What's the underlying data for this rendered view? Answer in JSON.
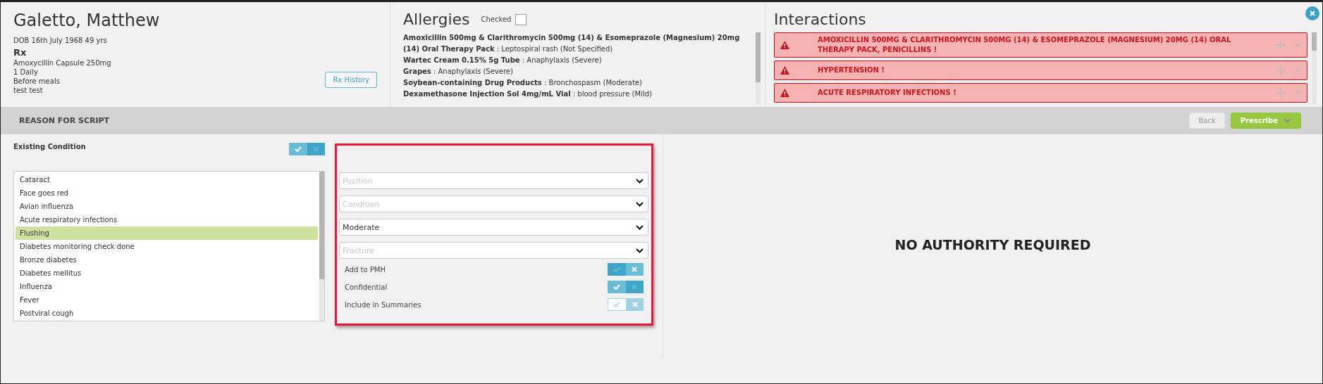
{
  "patient": {
    "name": "Galetto, Matthew",
    "dob": "DOB 16th July 1968 49 yrs",
    "rx_heading": "Rx",
    "rx_lines": [
      "Amoxycillin Capsule 250mg",
      "1 Daily",
      "Before meals",
      "test test"
    ],
    "history_button": "Rx History"
  },
  "allergies": {
    "title": "Allergies",
    "checked_label": "Checked",
    "checked": false,
    "items": [
      "**Amoxicillin 500mg & Clarithromycin 500mg (14) & Esomeprazole (Magnesium) 20mg (14) Oral Therapy Pack** : Leptospiral rash (Not Specified)",
      "**Wartec Cream 0.15% 5g Tube** : Anaphylaxis (Severe)",
      "**Grapes** : Anaphylaxis (Severe)",
      "**Soybean-containing Drug Products** : Bronchospasm (Moderate)",
      "**Dexamethasone Injection Sol 4mg/mL Vial** : blood pressure (Mild)"
    ]
  },
  "interactions": {
    "title": "Interactions",
    "items": [
      {
        "text": "AMOXICILLIN 500MG & CLARITHROMYCIN 500MG (14) & ESOMEPRAZOLE (MAGNESIUM) 20MG (14) ORAL THERAPY PACK, PENICILLINS !"
      },
      {
        "text": "HYPERTENSION !"
      },
      {
        "text": "ACUTE RESPIRATORY INFECTIONS !"
      }
    ]
  },
  "section_bar": {
    "title": "REASON FOR SCRIPT",
    "back_button": "Back",
    "prescribe_button": "Prescribe"
  },
  "existing_condition": {
    "label": "Existing Condition",
    "on": true,
    "disabled": false,
    "conditions": [
      {
        "label": "Cataract",
        "selected": false
      },
      {
        "label": "Face goes red",
        "selected": false
      },
      {
        "label": "Avian influenza",
        "selected": false
      },
      {
        "label": "Acute respiratory infections",
        "selected": false
      },
      {
        "label": "Flushing",
        "selected": true
      },
      {
        "label": "Diabetes monitoring check done",
        "selected": false
      },
      {
        "label": "Bronze diabetes",
        "selected": false
      },
      {
        "label": "Diabetes mellitus",
        "selected": false
      },
      {
        "label": "Influenza",
        "selected": false
      },
      {
        "label": "Fever",
        "selected": false
      },
      {
        "label": "Postviral cough",
        "selected": false
      }
    ]
  },
  "form": {
    "selects": [
      {
        "placeholder": "Position"
      },
      {
        "placeholder": "Condition"
      },
      {
        "value": "Moderate"
      },
      {
        "placeholder": "Fracture"
      }
    ],
    "options": [
      {
        "label": "Add to PMH",
        "on": false,
        "disabled": false
      },
      {
        "label": "Confidential",
        "on": true,
        "disabled": false
      },
      {
        "label": "Include in Summaries",
        "on": false,
        "disabled": true
      }
    ]
  },
  "authority": {
    "message": "NO AUTHORITY REQUIRED"
  }
}
